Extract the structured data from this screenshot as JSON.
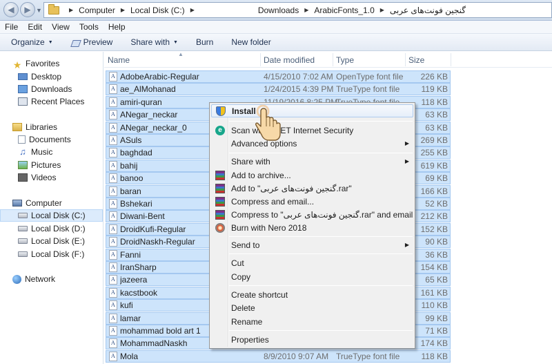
{
  "address": {
    "crumbs": [
      "Computer",
      "Local Disk (C:)",
      "Downloads",
      "ArabicFonts_1.0",
      "گنجین فونت‌های عربی"
    ]
  },
  "menubar": [
    "File",
    "Edit",
    "View",
    "Tools",
    "Help"
  ],
  "toolbar": {
    "organize": "Organize",
    "preview": "Preview",
    "share_with": "Share with",
    "burn": "Burn",
    "new_folder": "New folder"
  },
  "nav": {
    "favorites": "Favorites",
    "desktop": "Desktop",
    "downloads": "Downloads",
    "recent_places": "Recent Places",
    "libraries": "Libraries",
    "documents": "Documents",
    "music": "Music",
    "pictures": "Pictures",
    "videos": "Videos",
    "computer": "Computer",
    "local_c": "Local Disk (C:)",
    "local_d": "Local Disk (D:)",
    "local_e": "Local Disk (E:)",
    "local_f": "Local Disk (F:)",
    "network": "Network"
  },
  "columns": {
    "name": "Name",
    "date": "Date modified",
    "type": "Type",
    "size": "Size"
  },
  "files": [
    {
      "name": "AdobeArabic-Regular",
      "date": "4/15/2010 7:02 AM",
      "type": "OpenType font file",
      "size": "226 KB"
    },
    {
      "name": "ae_AlMohanad",
      "date": "1/24/2015 4:39 PM",
      "type": "TrueType font file",
      "size": "119 KB"
    },
    {
      "name": "amiri-quran",
      "date": "11/19/2016 8:25 PM",
      "type": "TrueType font file",
      "size": "118 KB"
    },
    {
      "name": "ANegar_neckar",
      "date": "",
      "type": "",
      "size": "63 KB"
    },
    {
      "name": "ANegar_neckar_0",
      "date": "",
      "type": "",
      "size": "63 KB"
    },
    {
      "name": "ASuls",
      "date": "",
      "type": "",
      "size": "269 KB"
    },
    {
      "name": "baghdad",
      "date": "",
      "type": "",
      "size": "255 KB"
    },
    {
      "name": "bahij",
      "date": "",
      "type": "",
      "size": "619 KB"
    },
    {
      "name": "banoo",
      "date": "",
      "type": "",
      "size": "69 KB"
    },
    {
      "name": "baran",
      "date": "",
      "type": "",
      "size": "166 KB"
    },
    {
      "name": "Bshekari",
      "date": "",
      "type": "",
      "size": "52 KB"
    },
    {
      "name": "Diwani-Bent",
      "date": "",
      "type": "",
      "size": "212 KB"
    },
    {
      "name": "DroidKufi-Regular",
      "date": "",
      "type": "",
      "size": "152 KB"
    },
    {
      "name": "DroidNaskh-Regular",
      "date": "",
      "type": "",
      "size": "90 KB"
    },
    {
      "name": "Fanni",
      "date": "",
      "type": "",
      "size": "36 KB"
    },
    {
      "name": "IranSharp",
      "date": "",
      "type": "",
      "size": "154 KB"
    },
    {
      "name": "jazeera",
      "date": "",
      "type": "",
      "size": "65 KB"
    },
    {
      "name": "kacstbook",
      "date": "",
      "type": "",
      "size": "161 KB"
    },
    {
      "name": "kufi",
      "date": "",
      "type": "",
      "size": "110 KB"
    },
    {
      "name": "lamar",
      "date": "",
      "type": "",
      "size": "99 KB"
    },
    {
      "name": "mohammad bold art 1",
      "date": "",
      "type": "",
      "size": "71 KB"
    },
    {
      "name": "MohammadNaskh",
      "date": "",
      "type": "",
      "size": "174 KB"
    },
    {
      "name": "Mola",
      "date": "8/9/2010 9:07 AM",
      "type": "TrueType font file",
      "size": "118 KB"
    }
  ],
  "context_menu": {
    "install": "Install",
    "scan": "Scan with ESET Internet Security",
    "advanced": "Advanced options",
    "share_with": "Share with",
    "add_archive": "Add to archive...",
    "add_rar": "Add to \"گنجین فونت‌های عربی.rar\"",
    "compress_email": "Compress and email...",
    "compress_rar_email": "Compress to \"گنجین فونت‌های عربی.rar\" and email",
    "burn_nero": "Burn with Nero 2018",
    "send_to": "Send to",
    "cut": "Cut",
    "copy": "Copy",
    "create_shortcut": "Create shortcut",
    "delete": "Delete",
    "rename": "Rename",
    "properties": "Properties"
  }
}
